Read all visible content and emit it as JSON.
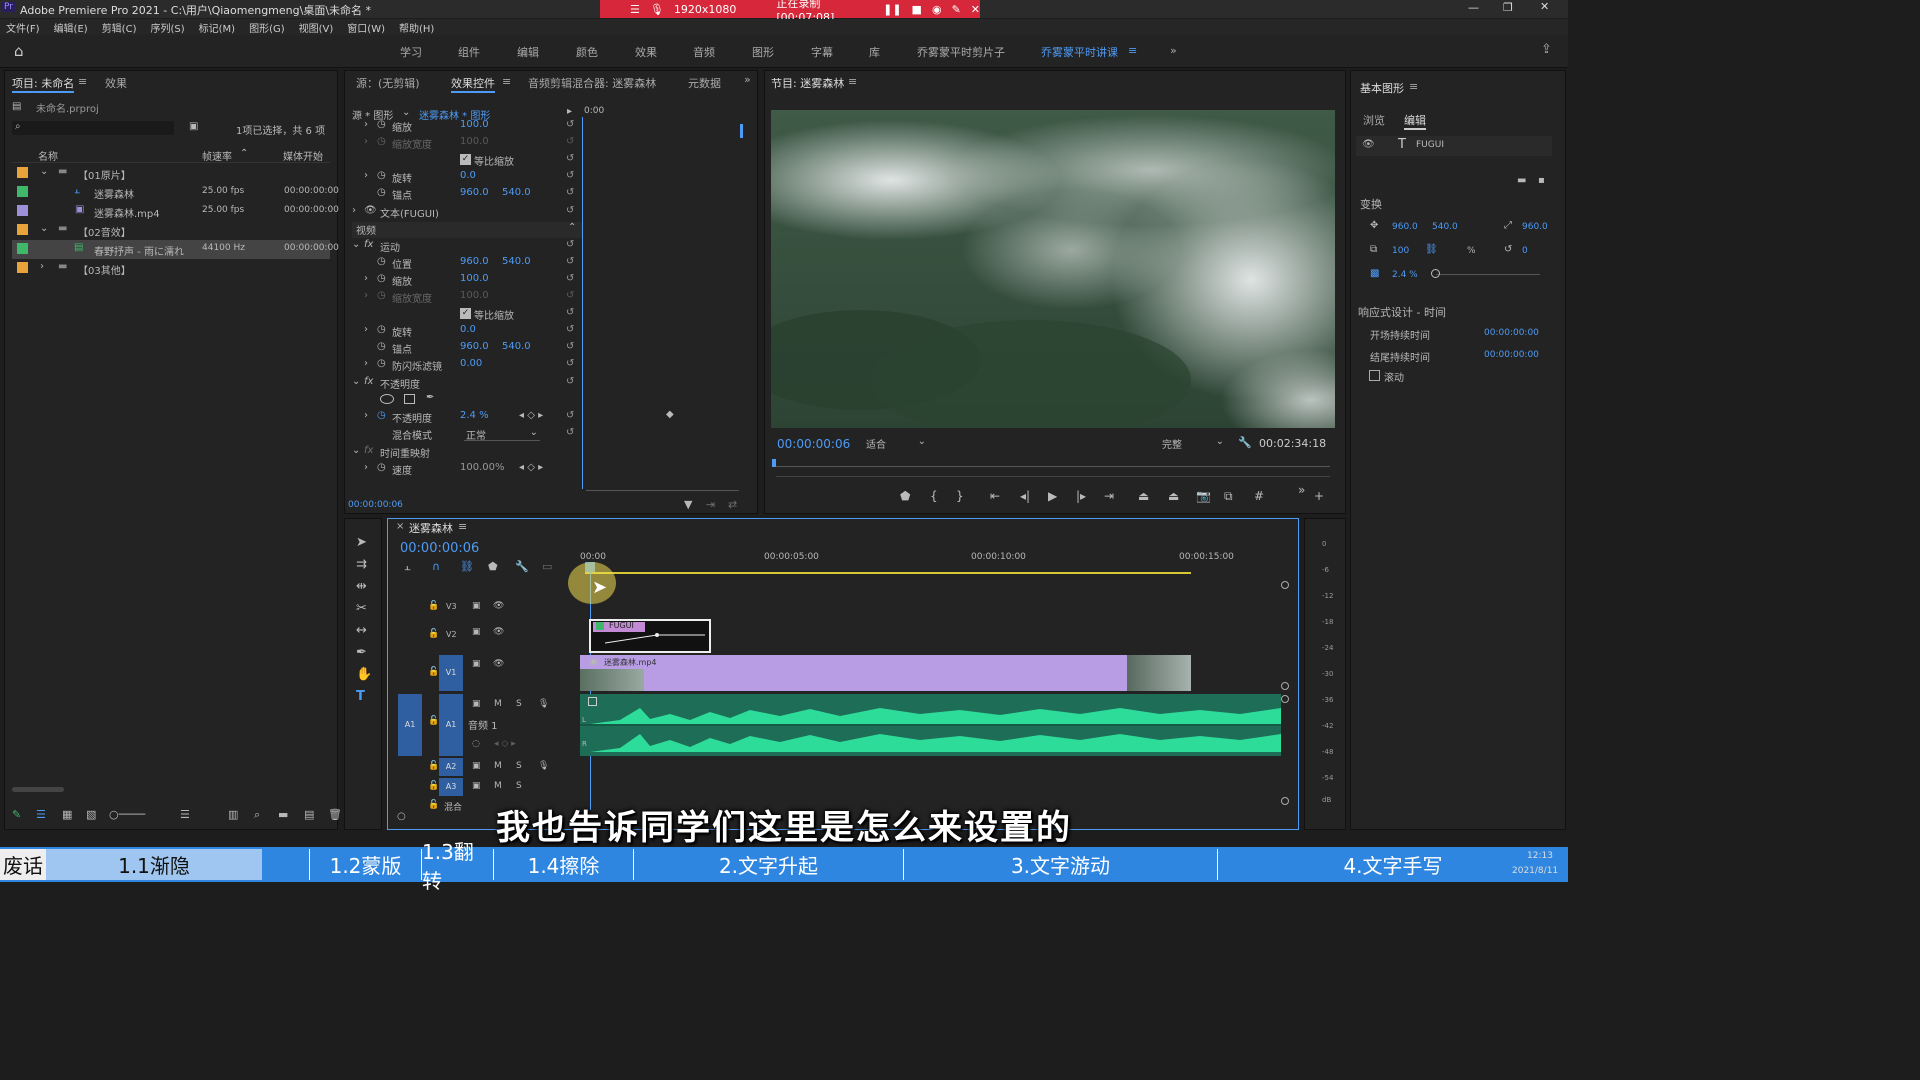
{
  "app": {
    "title": "Adobe Premiere Pro 2021 - C:\\用户\\Qiaomengmeng\\桌面\\未命名 *",
    "logo": "Pr"
  },
  "recorder": {
    "resolution": "1920x1080",
    "status": "正在录制 [00:07:08]"
  },
  "menu": [
    "文件(F)",
    "编辑(E)",
    "剪辑(C)",
    "序列(S)",
    "标记(M)",
    "图形(G)",
    "视图(V)",
    "窗口(W)",
    "帮助(H)"
  ],
  "workspaces": [
    "学习",
    "组件",
    "编辑",
    "颜色",
    "效果",
    "音频",
    "图形",
    "字幕",
    "库",
    "乔雾蒙平时剪片子",
    "乔雾蒙平时讲课"
  ],
  "project": {
    "tab": "项目: 未命名",
    "tab2": "效果",
    "file": "未命名.prproj",
    "search_placeholder": "",
    "selection": "1项已选择，共 6 项",
    "col_name": "名称",
    "col_fps": "帧速率",
    "col_start": "媒体开始",
    "rows": [
      {
        "name": "【01原片】",
        "fps": "",
        "start": "",
        "color": "#e8a33b",
        "kind": "folder"
      },
      {
        "name": "迷雾森林",
        "fps": "25.00 fps",
        "start": "00:00:00:00",
        "color": "#3fb86a",
        "kind": "seq"
      },
      {
        "name": "迷雾森林.mp4",
        "fps": "25.00 fps",
        "start": "00:00:00:00",
        "color": "#9e8fd9",
        "kind": "video"
      },
      {
        "name": "【02音效】",
        "fps": "",
        "start": "",
        "color": "#e8a33b",
        "kind": "folder"
      },
      {
        "name": "春野抒声 - 雨に濡れ",
        "fps": "44100 Hz",
        "start": "00:00:00:00",
        "color": "#3fb86a",
        "kind": "audio"
      },
      {
        "name": "【03其他】",
        "fps": "",
        "start": "",
        "color": "#e8a33b",
        "kind": "folder"
      }
    ]
  },
  "effects": {
    "tab_source": "源：(无剪辑)",
    "tab_fx": "效果控件",
    "tab_mixer": "音频剪辑混合器: 迷雾森林",
    "tab_meta": "元数据",
    "src": "源 * 图形",
    "clip": "迷雾森林 * 图形",
    "ruler": "0:00",
    "rows": [
      {
        "label": "缩放",
        "v1": "100.0",
        "v2": ""
      },
      {
        "label": "缩放宽度",
        "v1": "100.0",
        "v2": ""
      },
      {
        "label": "等比缩放",
        "v1": "",
        "v2": ""
      },
      {
        "label": "旋转",
        "v1": "0.0",
        "v2": ""
      },
      {
        "label": "锚点",
        "v1": "960.0",
        "v2": "540.0"
      },
      {
        "label": "文本(FUGUI)",
        "v1": "",
        "v2": ""
      },
      {
        "label": "视频",
        "v1": "",
        "v2": ""
      },
      {
        "label": "运动",
        "v1": "",
        "v2": ""
      },
      {
        "label": "位置",
        "v1": "960.0",
        "v2": "540.0"
      },
      {
        "label": "缩放",
        "v1": "100.0",
        "v2": ""
      },
      {
        "label": "缩放宽度",
        "v1": "100.0",
        "v2": ""
      },
      {
        "label": "等比缩放",
        "v1": "",
        "v2": ""
      },
      {
        "label": "旋转",
        "v1": "0.0",
        "v2": ""
      },
      {
        "label": "锚点",
        "v1": "960.0",
        "v2": "540.0"
      },
      {
        "label": "防闪烁滤镜",
        "v1": "0.00",
        "v2": ""
      },
      {
        "label": "不透明度",
        "v1": "",
        "v2": ""
      },
      {
        "label": "",
        "v1": "",
        "v2": ""
      },
      {
        "label": "不透明度",
        "v1": "2.4 %",
        "v2": ""
      },
      {
        "label": "混合模式",
        "v1": "正常",
        "v2": ""
      },
      {
        "label": "时间重映射",
        "v1": "",
        "v2": ""
      },
      {
        "label": "速度",
        "v1": "100.00%",
        "v2": ""
      }
    ],
    "timecode": "00:00:00:06"
  },
  "program": {
    "title": "节目: 迷雾森林",
    "timecode": "00:00:00:06",
    "fit": "适合",
    "quality": "完整",
    "duration": "00:02:34:18"
  },
  "graphics": {
    "title": "基本图形",
    "tab_browse": "浏览",
    "tab_edit": "编辑",
    "layer": "FUGUI",
    "transform": "变换",
    "posx": "960.0",
    "posy": "540.0",
    "scale": "960.0",
    "size": "100",
    "pct": "%",
    "rot": "0",
    "opacity": "2.4 %",
    "responsive": "响应式设计 - 时间",
    "intro": "开场持续时间",
    "intro_val": "00:00:00:00",
    "outro": "结尾持续时间",
    "outro_val": "00:00:00:00",
    "roll": "滚动"
  },
  "timeline": {
    "title": "迷雾森林",
    "timecode": "00:00:00:06",
    "ticks": [
      "00:00",
      "00:00:05:00",
      "00:00:10:00",
      "00:00:15:00"
    ],
    "tracks": [
      "V3",
      "V2",
      "V1",
      "A1",
      "A2",
      "A3"
    ],
    "audio_name": "音频 1",
    "mix": "混合",
    "clip_v2": "FUGUI",
    "clip_v1": "迷雾森林.mp4",
    "meter": [
      "0",
      "-6",
      "-12",
      "-18",
      "-24",
      "-30",
      "-36",
      "-42",
      "-48",
      "-54",
      "dB"
    ]
  },
  "subtitle": "我也告诉同学们这里是怎么来设置的",
  "chapters": [
    "废话",
    "1.1渐隐",
    "1.2蒙版",
    "1.3翻转",
    "1.4擦除",
    "2.文字升起",
    "3.文字游动",
    "4.文字手写"
  ],
  "clock": {
    "time": "12:13",
    "date": "2021/8/11"
  }
}
